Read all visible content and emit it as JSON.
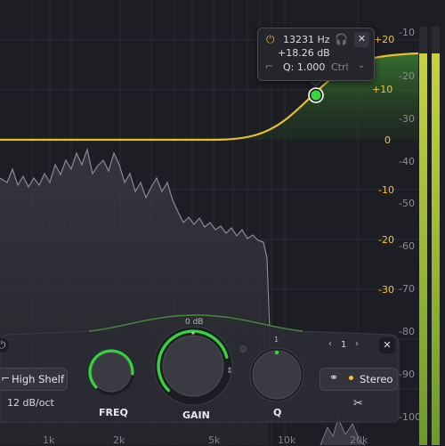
{
  "scale": {
    "left_db": [
      "+20",
      "+10",
      "0",
      "-10",
      "-20",
      "-30"
    ],
    "right_db": [
      "-10",
      "-20",
      "-30",
      "-40",
      "-50",
      "-60",
      "-70",
      "-80",
      "-90",
      "-100"
    ],
    "freq": [
      "1k",
      "2k",
      "5k",
      "10k",
      "20k"
    ]
  },
  "tooltip": {
    "frequency": "13231 Hz",
    "gain": "+18.26 dB",
    "q": "Q: 1.000",
    "modifier": "Ctrl",
    "power_icon": "power-icon",
    "solo_icon": "headphones-icon",
    "close_icon": "close-icon",
    "shape_icon": "high-shelf-icon",
    "menu_icon": "chevron-down-icon"
  },
  "band": {
    "shape": "High Shelf",
    "slope": "12 dB/oct",
    "band_number": "1",
    "gain_zero": "0 dB",
    "q_zero": "1",
    "stereo": "Stereo",
    "freq_label": "FREQ",
    "gain_label": "GAIN",
    "q_label": "Q",
    "freq_fill": 0.85,
    "gain_fill": 0.78,
    "q_fill": 0.5
  },
  "colors": {
    "accent_yellow": "#f2c230",
    "knob_green": "#35d43b",
    "meter_green": "#a8c035",
    "background": "#1d1e24"
  }
}
